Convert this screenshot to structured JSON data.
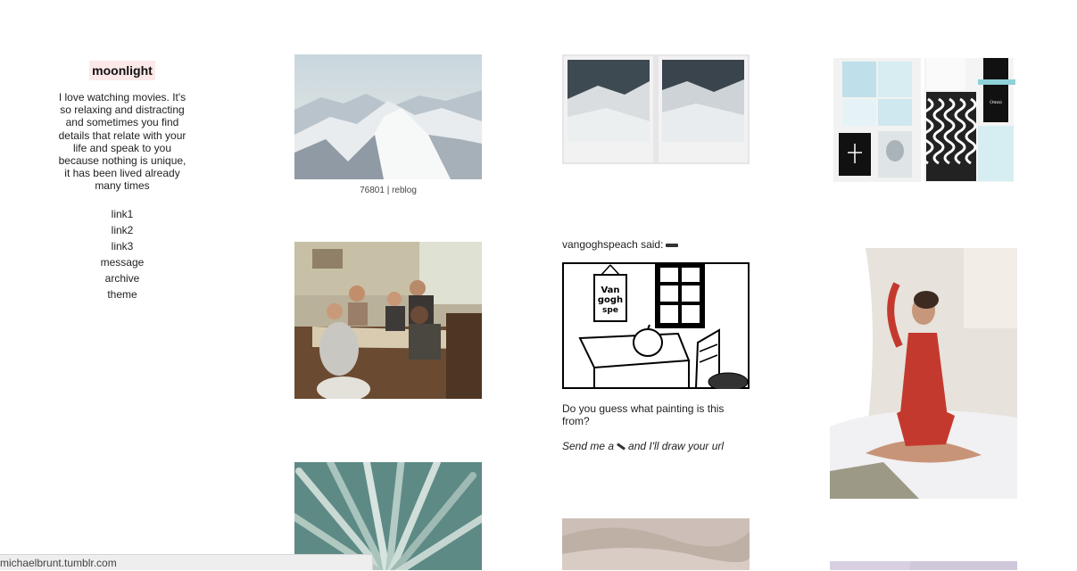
{
  "sidebar": {
    "title": "moonlight",
    "bio": "I love watching movies. It's so relaxing and distracting and sometimes you find details that relate with your life and speak to you because nothing is unique, it has been lived already many times",
    "links": [
      "link1",
      "link2",
      "link3",
      "message",
      "archive",
      "theme"
    ]
  },
  "posts": {
    "mountain": {
      "notes": "76801",
      "separator": "|",
      "reblog": "reblog"
    },
    "ask": {
      "asker": "vangoghspeach said:",
      "drawing_text": "Van gogh spe ech",
      "question": "Do you guess what painting is this from?",
      "send_before": "Send me a",
      "send_after": "and I'll draw your url"
    }
  },
  "statusbar": {
    "url": "michaelbrunt.tumblr.com"
  },
  "colors": {
    "title_highlight": "#fce8e8",
    "statusbar_bg": "#eeeeee"
  }
}
